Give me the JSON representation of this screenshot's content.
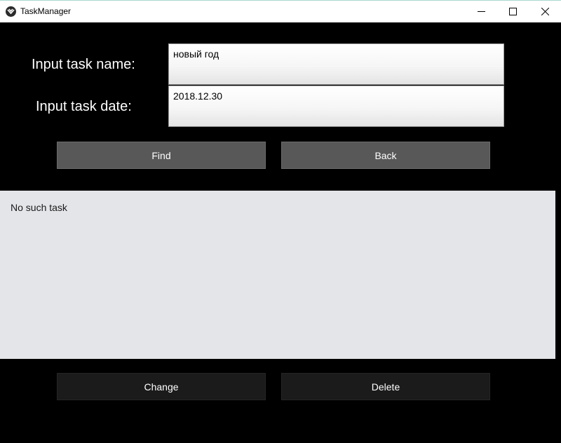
{
  "window": {
    "title": "TaskManager",
    "controls": [
      "minimize-icon",
      "maximize-icon",
      "close-icon"
    ]
  },
  "form": {
    "name_label": "Input task name:",
    "name_value": "новый год",
    "date_label": "Input task date:",
    "date_value": "2018.12.30"
  },
  "buttons": {
    "find": "Find",
    "back": "Back",
    "change": "Change",
    "delete": "Delete"
  },
  "result": {
    "text": "No such task"
  },
  "colors": {
    "background": "#000000",
    "titlebar": "#ffffff",
    "button_active": "#585858",
    "button_inactive": "#1b1b1b",
    "panel": "#e4e5e9"
  }
}
